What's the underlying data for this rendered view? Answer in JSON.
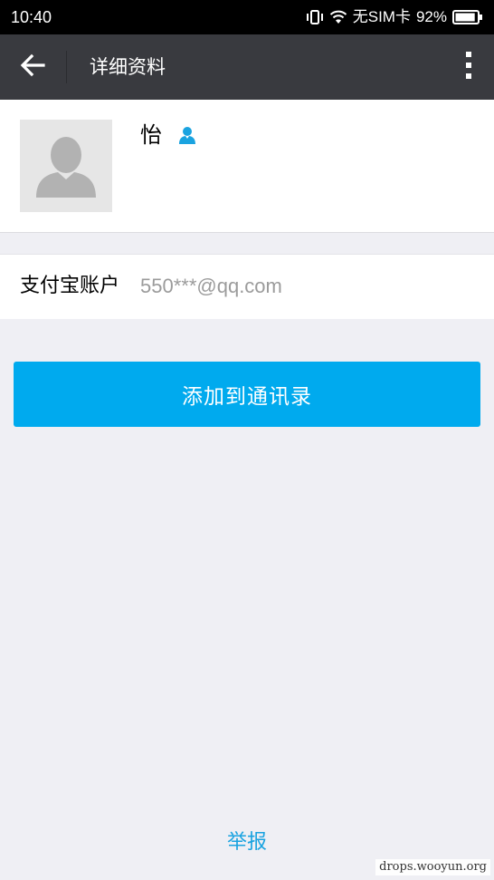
{
  "status_bar": {
    "time": "10:40",
    "carrier": "无SIM卡",
    "battery": "92%",
    "battery_level": 0.92,
    "icons": [
      "vibrate-icon",
      "wifi-icon",
      "battery-icon"
    ]
  },
  "header": {
    "back_icon": "arrow-left-icon",
    "title": "详细资料",
    "more_icon": "more-vertical-icon"
  },
  "profile": {
    "name": "怡",
    "avatar_icon": "default-avatar-icon",
    "badge_icon": "user-badge-icon"
  },
  "account": {
    "label": "支付宝账户",
    "value": "550***@qq.com"
  },
  "actions": {
    "add_contact": "添加到通讯录",
    "report": "举报"
  },
  "watermark": "drops.wooyun.org",
  "colors": {
    "status_bar_bg": "#000000",
    "header_bg": "#393a3f",
    "page_bg": "#efeff4",
    "accent": "#00aaee",
    "link": "#1aa3e0"
  }
}
